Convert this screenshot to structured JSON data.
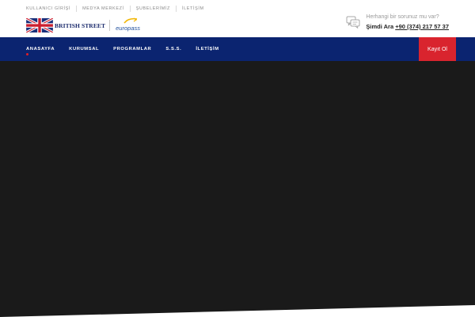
{
  "topbar": {
    "links": [
      "KULLANICI GİRİŞİ",
      "MEDYA MERKEZİ",
      "ŞUBELERİMİZ",
      "İLETİŞİM"
    ]
  },
  "logo": {
    "brand": "BRITISH STREET",
    "partner": "europass"
  },
  "contact": {
    "question": "Herhangi bir sorunuz mu var?",
    "call_label": "Şimdi Ara",
    "phone": "+90 (374) 217 57 37"
  },
  "nav": {
    "items": [
      "ANASAYFA",
      "KURUMSAL",
      "PROGRAMLAR",
      "S.S.S.",
      "İLETİŞİM"
    ],
    "active_index": 0,
    "register_label": "Kayıt Ol"
  },
  "colors": {
    "nav_bg": "#0b2470",
    "accent_red": "#d9242e",
    "hero_bg": "#1a1a1a"
  }
}
